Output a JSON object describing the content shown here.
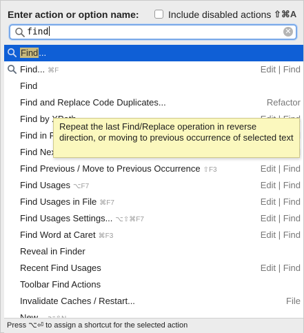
{
  "header": {
    "label": "Enter action or option name:",
    "checkbox_label": "Include disabled actions",
    "checkbox_checked": false,
    "shortcut": "⇧⌘A"
  },
  "search": {
    "value": "find",
    "search_icon": "search-icon",
    "clear_icon": "clear-icon",
    "clear_glyph": "✕"
  },
  "results": [
    {
      "name_highlight": "Find",
      "name_rest": "...",
      "shortcut": "",
      "group": "",
      "icon": "search-icon",
      "selected": true
    },
    {
      "name_highlight": "",
      "name_rest": "Find...",
      "shortcut": "⌘F",
      "group": "Edit | Find",
      "icon": "search-icon",
      "selected": false
    },
    {
      "name_highlight": "",
      "name_rest": "Find",
      "shortcut": "",
      "group": "",
      "icon": "",
      "selected": false
    },
    {
      "name_highlight": "",
      "name_rest": "Find and Replace Code Duplicates...",
      "shortcut": "",
      "group": "Refactor",
      "icon": "",
      "selected": false
    },
    {
      "name_highlight": "",
      "name_rest": "Find by XPath",
      "shortcut": "",
      "group": "Edit | Find",
      "icon": "",
      "selected": false
    },
    {
      "name_highlight": "",
      "name_rest": "Find in Path",
      "shortcut": "",
      "group": "Edit | Find",
      "icon": "",
      "selected": false
    },
    {
      "name_highlight": "",
      "name_rest": "Find Next",
      "shortcut": "",
      "group": "Edit | Find",
      "icon": "",
      "selected": false
    },
    {
      "name_highlight": "",
      "name_rest": "Find Previous / Move to Previous Occurrence",
      "shortcut": "⇧F3",
      "group": "Edit | Find",
      "icon": "",
      "selected": false
    },
    {
      "name_highlight": "",
      "name_rest": "Find Usages",
      "shortcut": "⌥F7",
      "group": "Edit | Find",
      "icon": "",
      "selected": false
    },
    {
      "name_highlight": "",
      "name_rest": "Find Usages in File",
      "shortcut": "⌘F7",
      "group": "Edit | Find",
      "icon": "",
      "selected": false
    },
    {
      "name_highlight": "",
      "name_rest": "Find Usages Settings...",
      "shortcut": "⌥⇧⌘F7",
      "group": "Edit | Find",
      "icon": "",
      "selected": false
    },
    {
      "name_highlight": "",
      "name_rest": "Find Word at Caret",
      "shortcut": "⌘F3",
      "group": "Edit | Find",
      "icon": "",
      "selected": false
    },
    {
      "name_highlight": "",
      "name_rest": "Reveal in Finder",
      "shortcut": "",
      "group": "",
      "icon": "",
      "selected": false
    },
    {
      "name_highlight": "",
      "name_rest": "Recent Find Usages",
      "shortcut": "",
      "group": "Edit | Find",
      "icon": "",
      "selected": false
    },
    {
      "name_highlight": "",
      "name_rest": "Toolbar Find Actions",
      "shortcut": "",
      "group": "",
      "icon": "",
      "selected": false
    },
    {
      "name_highlight": "",
      "name_rest": "Invalidate Caches / Restart...",
      "shortcut": "",
      "group": "File",
      "icon": "",
      "selected": false
    },
    {
      "name_highlight": "",
      "name_rest": "New...",
      "shortcut": "⌥⇧N",
      "group": "",
      "icon": "",
      "selected": false
    }
  ],
  "tooltip": {
    "text": "Repeat the last Find/Replace operation in reverse direction, or moving to previous occurrence of selected text"
  },
  "footer": {
    "text": "Press ⌥⏎ to assign a shortcut for the selected action"
  },
  "colors": {
    "selection": "#0f5fd6",
    "match_highlight": "#c9b97c",
    "tooltip_bg": "#fbf8be",
    "focus_ring": "#7aa9e8"
  }
}
